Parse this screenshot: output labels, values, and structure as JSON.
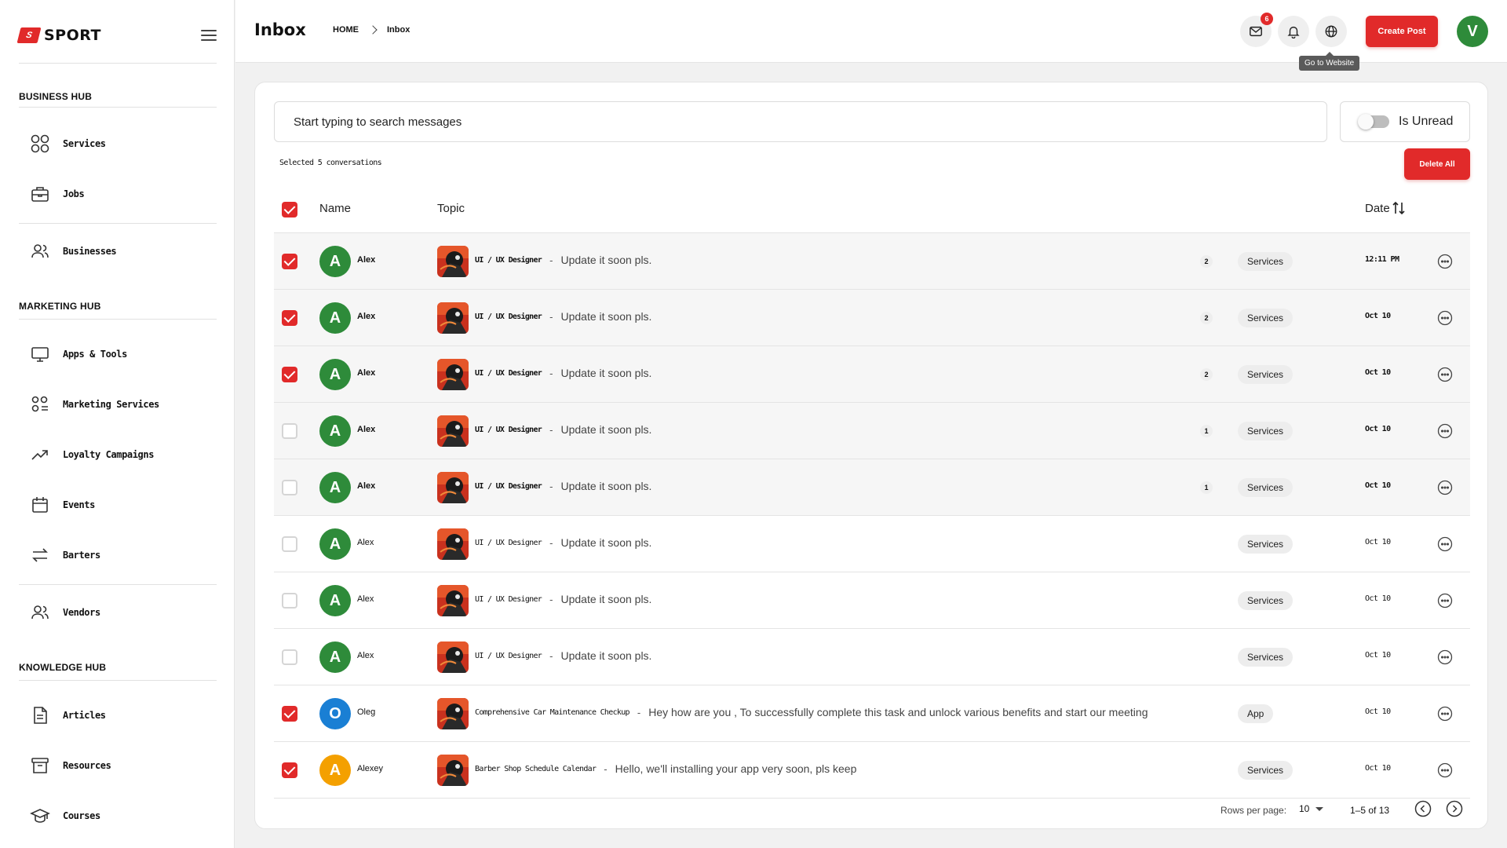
{
  "brand": {
    "mark": "S",
    "name": "SPORT"
  },
  "sidebar": {
    "sections": [
      {
        "title": "BUSINESS HUB"
      },
      {
        "title": "MARKETING HUB"
      },
      {
        "title": "KNOWLEDGE HUB"
      }
    ],
    "items": [
      {
        "label": "Services",
        "icon": "grid-icon"
      },
      {
        "label": "Jobs",
        "icon": "briefcase-icon"
      },
      {
        "label": "Businesses",
        "icon": "users-icon"
      },
      {
        "label": "Apps & Tools",
        "icon": "monitor-icon"
      },
      {
        "label": "Marketing Services",
        "icon": "apps-list-icon"
      },
      {
        "label": "Loyalty Campaigns",
        "icon": "trending-up-icon"
      },
      {
        "label": "Events",
        "icon": "calendar-icon"
      },
      {
        "label": "Barters",
        "icon": "swap-icon"
      },
      {
        "label": "Vendors",
        "icon": "users-icon"
      },
      {
        "label": "Articles",
        "icon": "document-icon"
      },
      {
        "label": "Resources",
        "icon": "archive-icon"
      },
      {
        "label": "Courses",
        "icon": "graduation-cap-icon"
      }
    ]
  },
  "header": {
    "title": "Inbox",
    "breadcrumb": [
      "HOME",
      "Inbox"
    ],
    "mail_badge": "6",
    "tooltip": "Go to Website",
    "create_label": "Create Post",
    "avatar_letter": "V"
  },
  "inbox": {
    "search_placeholder": "Start typing to search messages",
    "unread_filter_label": "Is Unread",
    "unread_filter_on": false,
    "selected_text": "Selected 5 conversations",
    "delete_all_label": "Delete All",
    "columns": {
      "name": "Name",
      "topic": "Topic",
      "date": "Date"
    },
    "header_checkbox_checked": true,
    "rows": [
      {
        "checked": true,
        "unread": true,
        "avatar": "A",
        "avatar_color": "#2e8b3a",
        "name": "Alex",
        "topic": "UI / UX Designer",
        "message": "Update it soon pls.",
        "count": "2",
        "tag": "Services",
        "date": "12:11 PM"
      },
      {
        "checked": true,
        "unread": true,
        "avatar": "A",
        "avatar_color": "#2e8b3a",
        "name": "Alex",
        "topic": "UI / UX Designer",
        "message": "Update it soon pls.",
        "count": "2",
        "tag": "Services",
        "date": "Oct 10"
      },
      {
        "checked": true,
        "unread": true,
        "avatar": "A",
        "avatar_color": "#2e8b3a",
        "name": "Alex",
        "topic": "UI / UX Designer",
        "message": "Update it soon pls.",
        "count": "2",
        "tag": "Services",
        "date": "Oct 10"
      },
      {
        "checked": false,
        "unread": true,
        "avatar": "A",
        "avatar_color": "#2e8b3a",
        "name": "Alex",
        "topic": "UI / UX Designer",
        "message": "Update it soon pls.",
        "count": "1",
        "tag": "Services",
        "date": "Oct 10"
      },
      {
        "checked": false,
        "unread": true,
        "avatar": "A",
        "avatar_color": "#2e8b3a",
        "name": "Alex",
        "topic": "UI / UX Designer",
        "message": "Update it soon pls.",
        "count": "1",
        "tag": "Services",
        "date": "Oct 10"
      },
      {
        "checked": false,
        "unread": false,
        "avatar": "A",
        "avatar_color": "#2e8b3a",
        "name": "Alex",
        "topic": "UI / UX Designer",
        "message": "Update it soon pls.",
        "count": "",
        "tag": "Services",
        "date": "Oct 10"
      },
      {
        "checked": false,
        "unread": false,
        "avatar": "A",
        "avatar_color": "#2e8b3a",
        "name": "Alex",
        "topic": "UI / UX Designer",
        "message": "Update it soon pls.",
        "count": "",
        "tag": "Services",
        "date": "Oct 10"
      },
      {
        "checked": false,
        "unread": false,
        "avatar": "A",
        "avatar_color": "#2e8b3a",
        "name": "Alex",
        "topic": "UI / UX Designer",
        "message": "Update it soon pls.",
        "count": "",
        "tag": "Services",
        "date": "Oct 10"
      },
      {
        "checked": true,
        "unread": false,
        "avatar": "O",
        "avatar_color": "#1a7fd4",
        "name": "Oleg",
        "topic": "Comprehensive Car Maintenance Checkup",
        "message": "Hey how are you , To successfully complete this task and unlock various benefits and start our meeting",
        "count": "",
        "tag": "App",
        "date": "Oct 10"
      },
      {
        "checked": true,
        "unread": false,
        "avatar": "A",
        "avatar_color": "#f4a000",
        "avatar_display": "A",
        "name": "Alexey",
        "topic": "Barber Shop Schedule Calendar",
        "message": "Hello, we'll installing your app very soon, pls keep",
        "count": "",
        "tag": "Services",
        "date": "Oct 10"
      }
    ],
    "pagination": {
      "rows_per_page_label": "Rows per page:",
      "rows_per_page": "10",
      "range": "1–5 of 13"
    }
  },
  "colors": {
    "accent": "#e12a2a",
    "avatar_green": "#2e8b3a",
    "avatar_blue": "#1a7fd4",
    "avatar_orange": "#f4a000"
  }
}
